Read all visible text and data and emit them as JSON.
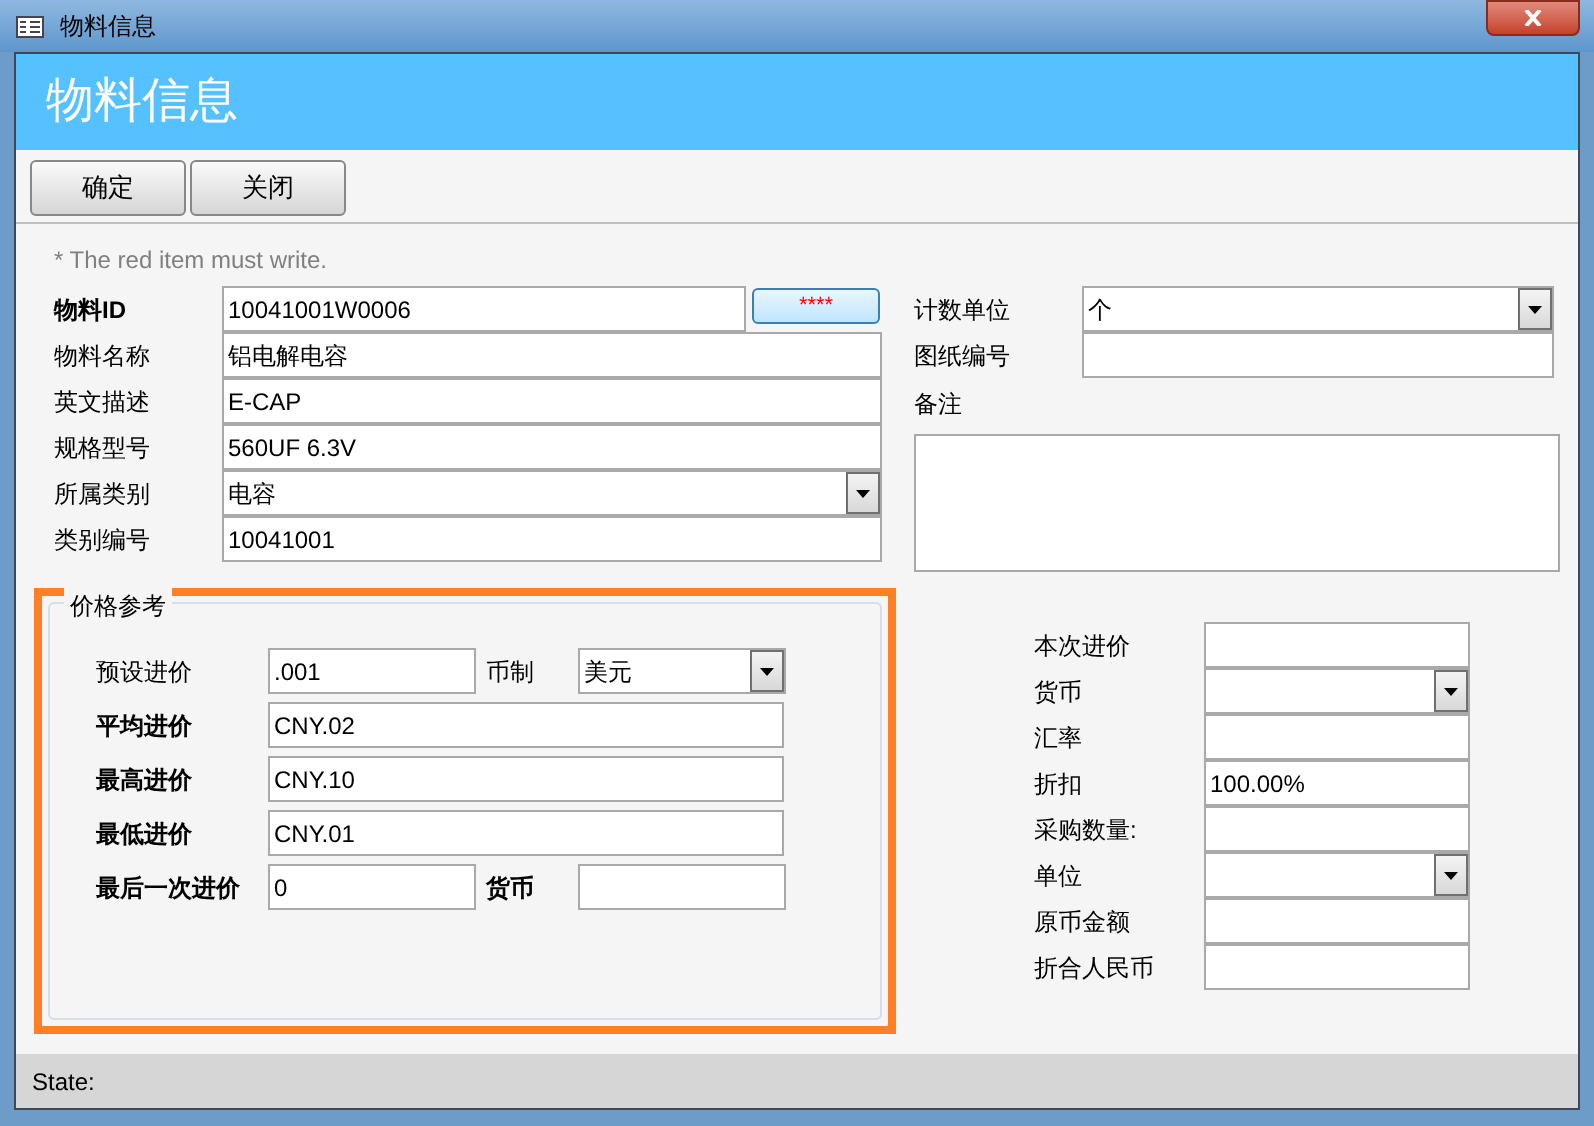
{
  "window": {
    "title": "物料信息"
  },
  "header": {
    "title": "物料信息"
  },
  "toolbar": {
    "buttons": [
      "确定",
      "关闭"
    ]
  },
  "note": "* The red item must write.",
  "main_fields": [
    {
      "label": "物料ID",
      "value": "10041001W0006",
      "kind": "text_button",
      "bold": true,
      "button": "****"
    },
    {
      "label": "物料名称",
      "value": "铝电解电容",
      "kind": "text",
      "bold": false
    },
    {
      "label": "英文描述",
      "value": "E-CAP",
      "kind": "text",
      "bold": false
    },
    {
      "label": "规格型号",
      "value": "560UF 6.3V",
      "kind": "text",
      "bold": false
    },
    {
      "label": "所属类别",
      "value": "电容",
      "kind": "dropdown",
      "bold": false
    },
    {
      "label": "类别编号",
      "value": "10041001",
      "kind": "text",
      "bold": false
    }
  ],
  "right_fields": [
    {
      "label": "计数单位",
      "value": "个",
      "kind": "dropdown"
    },
    {
      "label": "图纸编号",
      "kind": "text"
    }
  ],
  "remarks": {
    "label": "备注"
  },
  "price_group": {
    "title": "价格参考",
    "rows": [
      [
        {
          "label": "预设进价",
          "value": ".001",
          "kind": "text",
          "bold": false
        },
        {
          "label": "币制",
          "value": "美元",
          "kind": "dropdown",
          "bold": false
        }
      ],
      [
        {
          "label": "平均进价",
          "value": "CNY.02",
          "kind": "text",
          "bold": true
        }
      ],
      [
        {
          "label": "最高进价",
          "value": "CNY.10",
          "kind": "text",
          "bold": true
        }
      ],
      [
        {
          "label": "最低进价",
          "value": "CNY.01",
          "kind": "text",
          "bold": true
        }
      ],
      [
        {
          "label": "最后一次进价",
          "value": "0",
          "kind": "text",
          "bold": true
        },
        {
          "label": "货币",
          "kind": "text",
          "bold": true
        }
      ]
    ]
  },
  "purchase_fields": [
    {
      "label": "本次进价",
      "kind": "text"
    },
    {
      "label": "货币",
      "kind": "dropdown"
    },
    {
      "label": "汇率",
      "kind": "text"
    },
    {
      "label": "折扣",
      "value": "100.00%",
      "kind": "text"
    },
    {
      "label": "采购数量:",
      "kind": "text"
    },
    {
      "label": "单位",
      "kind": "dropdown"
    },
    {
      "label": "原币金额",
      "kind": "text"
    },
    {
      "label": "折合人民币",
      "kind": "text"
    }
  ],
  "status_bar": {
    "label": "State:"
  }
}
